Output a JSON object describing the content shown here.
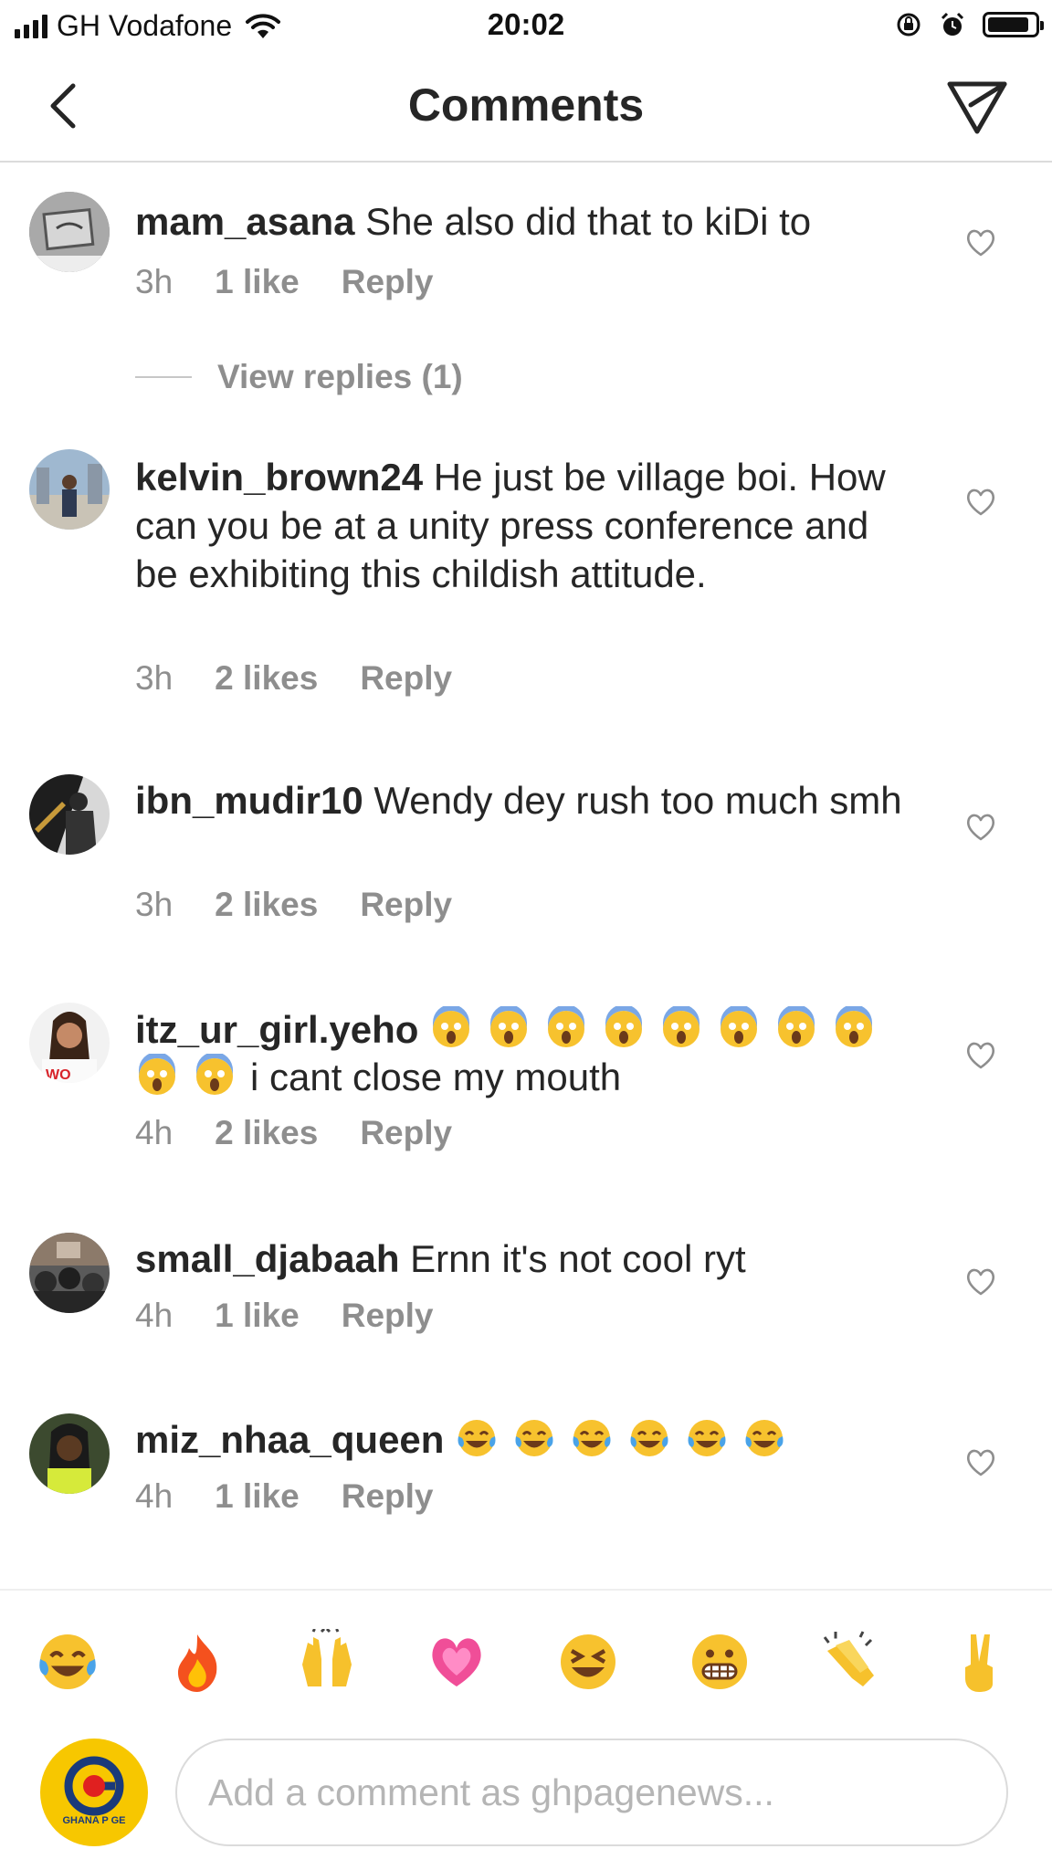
{
  "status_bar": {
    "carrier": "GH Vodafone",
    "time": "20:02"
  },
  "header": {
    "title": "Comments"
  },
  "comments": [
    {
      "username": "mam_asana",
      "text": "She also did that to kiDi to",
      "time": "3h",
      "likes": "1 like",
      "reply": "Reply"
    },
    {
      "username": "kelvin_brown24",
      "text": "He just be village boi. How can you be at a unity press conference and be exhibiting this childish attitude.",
      "time": "3h",
      "likes": "2 likes",
      "reply": "Reply"
    },
    {
      "username": "ibn_mudir10",
      "text": "Wendy dey rush too much smh",
      "time": "3h",
      "likes": "2 likes",
      "reply": "Reply"
    },
    {
      "username": "itz_ur_girl.yeho",
      "emojis": "screaming-face x10",
      "text": "i cant close my mouth",
      "time": "4h",
      "likes": "2 likes",
      "reply": "Reply"
    },
    {
      "username": "small_djabaah",
      "text": "Ernn it's not cool ryt",
      "time": "4h",
      "likes": "1 like",
      "reply": "Reply"
    },
    {
      "username": "miz_nhaa_queen",
      "emojis": "tears-of-joy x6",
      "time": "4h",
      "likes": "1 like",
      "reply": "Reply"
    }
  ],
  "view_replies": "View replies (1)",
  "emoji_bar": [
    "tears-of-joy",
    "fire",
    "raising-hands",
    "growing-heart",
    "grinning-squinting",
    "grimacing",
    "clapping-hands",
    "victory-hand"
  ],
  "composer": {
    "placeholder": "Add a comment as ghpagenews...",
    "avatar_brand": "GHANA P GE"
  }
}
